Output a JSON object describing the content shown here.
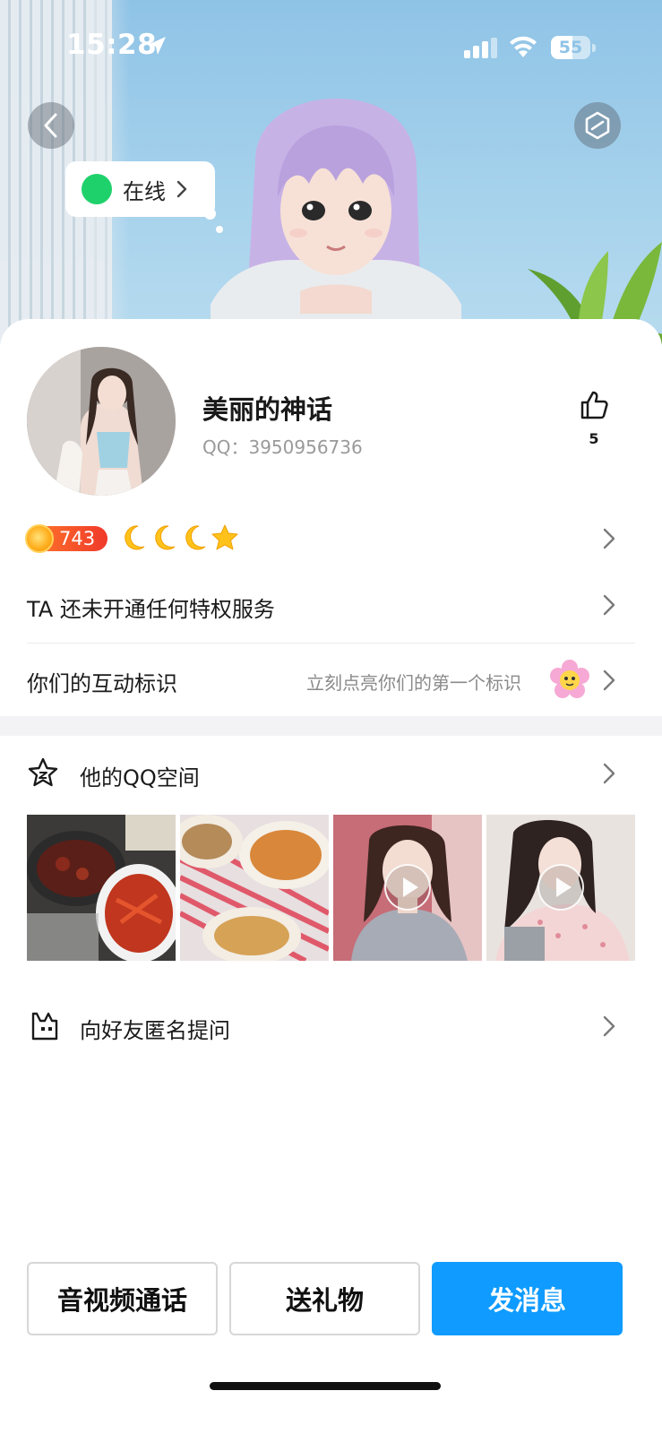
{
  "status_bar": {
    "time": "15:28",
    "battery": "55",
    "battery_level": 0.55
  },
  "header": {
    "online_status": "在线"
  },
  "profile": {
    "nickname": "美丽的神话",
    "qq_label": "QQ：3950956736",
    "like_count": "5",
    "level": "743",
    "level_icons": [
      "moon-icon",
      "moon-icon",
      "moon-icon",
      "star-icon"
    ]
  },
  "rows": {
    "privilege": "TA 还未开通任何特权服务",
    "interaction_label": "你们的互动标识",
    "interaction_hint": "立刻点亮你们的第一个标识"
  },
  "qzone": {
    "title": "他的QQ空间",
    "thumbnails": [
      {
        "name": "crayfish-dinner-photo",
        "video": false
      },
      {
        "name": "noodles-table-photo",
        "video": false
      },
      {
        "name": "selfie-video-1",
        "video": true
      },
      {
        "name": "selfie-video-2",
        "video": true
      }
    ]
  },
  "ask": {
    "label": "向好友匿名提问"
  },
  "actions": {
    "call": "音视频通话",
    "gift": "送礼物",
    "message": "发消息"
  },
  "colors": {
    "accent": "#0f9bff",
    "online": "#1fd16b",
    "level_badge": "#f0392b"
  }
}
